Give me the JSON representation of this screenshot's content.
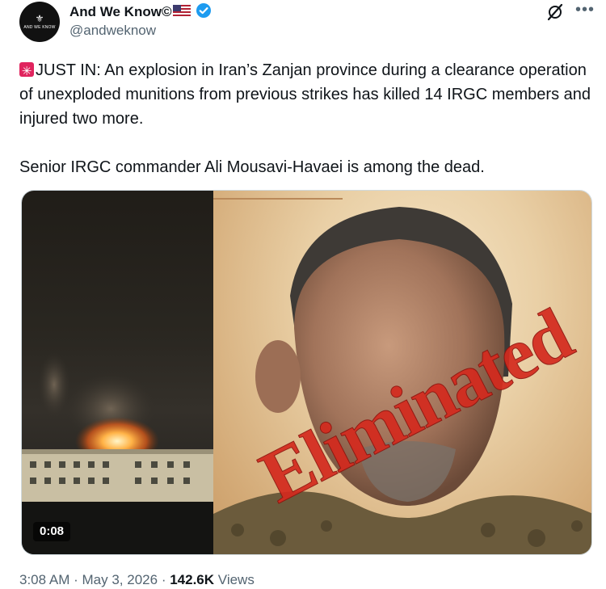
{
  "author": {
    "display_name": "And We Know©",
    "handle": "@andweknow",
    "avatar_text": "AND WE KNOW",
    "flag_icon": "us-flag-icon",
    "verified_icon": "verified-badge-icon",
    "verified_color": "#1d9bf0"
  },
  "header_actions": {
    "grok_icon": "grok-icon",
    "more_icon": "more-icon"
  },
  "tweet": {
    "line1": "JUST IN: An explosion in Iran’s Zanjan province during a clearance operation of unexploded munitions from previous strikes has killed 14 IRGC members and injured two more.",
    "line2": "Senior IRGC commander Ali Mousavi-Havaei is among the dead.",
    "siren_icon": "siren-icon"
  },
  "media": {
    "video_duration": "0:08",
    "overlay_text": "Eliminated"
  },
  "meta": {
    "time": "3:08 AM",
    "separator": "·",
    "date": "May 3, 2026",
    "views_count": "142.6K",
    "views_label": "Views"
  },
  "colors": {
    "text": "#0f1419",
    "secondary": "#536471",
    "stamp_red": "#d42a1e"
  }
}
